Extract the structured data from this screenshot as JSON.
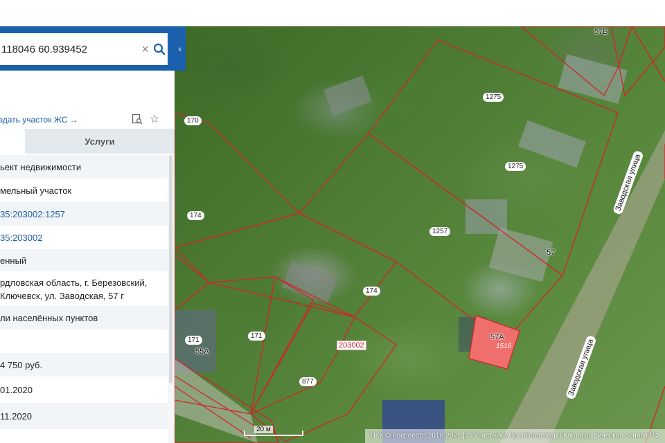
{
  "search": {
    "value": "118046 60.939452",
    "clear_glyph": "×"
  },
  "sidebar": {
    "collapse_glyph": "‹",
    "create_link": "оздать участок ЖС →",
    "tabs": [
      {
        "label": ""
      },
      {
        "label": "Услуги"
      }
    ],
    "rows": [
      {
        "text": "ьект недвижимости",
        "style": "alt"
      },
      {
        "text": "мельный участок",
        "style": "plain"
      },
      {
        "text": "35:203002:1257",
        "style": "alt-link"
      },
      {
        "text": "35:203002",
        "style": "link"
      },
      {
        "text": "енный",
        "style": "alt"
      },
      {
        "text": "рдловская область, г. Березовский, Ключевск, ул. Заводская, 57 г",
        "style": "multi"
      },
      {
        "text": "ли населённых пунктов",
        "style": "alt"
      },
      {
        "text": "",
        "style": "plain"
      },
      {
        "text": "4 750 руб.",
        "style": "alt"
      },
      {
        "text": "01.2020",
        "style": "plain"
      },
      {
        "text": "11.2020",
        "style": "alt"
      }
    ]
  },
  "map": {
    "parcel_labels": [
      "1275",
      "1275",
      "170",
      "174",
      "1257",
      "174",
      "171",
      "171",
      "877",
      "1516"
    ],
    "house_labels": [
      "57Б",
      "57",
      "57А",
      "55А"
    ],
    "quarter_label": "203002",
    "road_label": "Заводская улица",
    "road_label_2": "Заводская улица",
    "scale_label": "20 м",
    "attribution": "ПКК © Росреестр 2010-2021 | © Участники OpenStreetMap | Картографическая основа РФ",
    "parcel_stroke": "#d2232a",
    "highlight_fill": "#ef6f6c"
  }
}
